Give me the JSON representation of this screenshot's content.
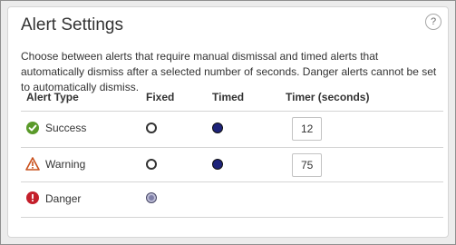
{
  "panel": {
    "title": "Alert Settings",
    "help_label": "?",
    "description": "Choose between alerts that require manual dismissal and timed alerts that automatically dismiss after a selected number of seconds. Danger alerts cannot be set to automatically dismiss."
  },
  "table": {
    "headers": {
      "alert_type": "Alert Type",
      "fixed": "Fixed",
      "timed": "Timed",
      "timer": "Timer (seconds)"
    },
    "rows": [
      {
        "label": "Success",
        "icon": "check-circle-icon",
        "icon_color": "#5a9a2a",
        "fixed_selected": false,
        "timed_selected": true,
        "timer": "12"
      },
      {
        "label": "Warning",
        "icon": "warning-triangle-icon",
        "icon_color": "#c9501c",
        "fixed_selected": false,
        "timed_selected": true,
        "timer": "75"
      },
      {
        "label": "Danger",
        "icon": "exclamation-circle-icon",
        "icon_color": "#c41f2b",
        "fixed_selected": true,
        "fixed_disabled": true
      }
    ]
  }
}
